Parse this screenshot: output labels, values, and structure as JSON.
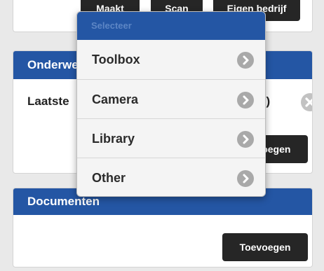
{
  "top_panel": {
    "buttons": [
      "Maakt",
      "Scan",
      "Eigen bedrijf"
    ]
  },
  "onderwerp_panel": {
    "header": "Onderwerp",
    "row_text": "Laatste",
    "row_text_right": "RA)",
    "add_button": "Toevoegen"
  },
  "documenten_panel": {
    "header": "Documenten",
    "add_button": "Toevoegen"
  },
  "popover": {
    "title": "Selecteer",
    "items": [
      {
        "label": "Toolbox",
        "icon": "chevron-right-icon"
      },
      {
        "label": "Camera",
        "icon": "chevron-right-icon"
      },
      {
        "label": "Library",
        "icon": "chevron-right-icon"
      },
      {
        "label": "Other",
        "icon": "chevron-right-icon"
      }
    ]
  },
  "colors": {
    "header_blue": "#2456a4",
    "button_dark": "#262626",
    "page_bg": "#e9e9e9"
  }
}
